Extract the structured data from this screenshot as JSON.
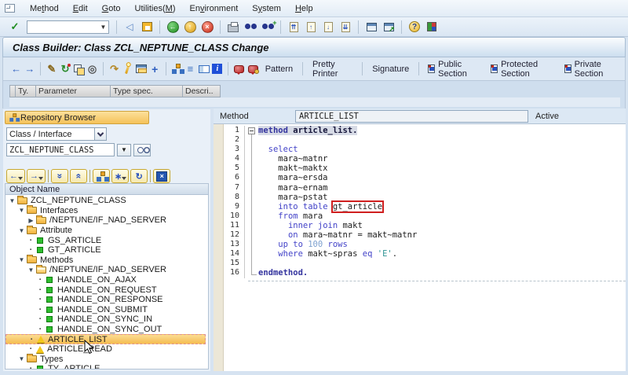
{
  "menubar": {
    "items": [
      {
        "label": "Method",
        "accel": 2
      },
      {
        "label": "Edit",
        "accel": 0
      },
      {
        "label": "Goto",
        "accel": 0
      },
      {
        "label": "Utilities(M)",
        "accel": 10
      },
      {
        "label": "Environment",
        "accel": 2
      },
      {
        "label": "System",
        "accel": 1
      },
      {
        "label": "Help",
        "accel": 0
      }
    ]
  },
  "systoolbar": {
    "command_field": {
      "value": "",
      "placeholder": ""
    },
    "icons": [
      "enter-check",
      "command-field",
      "sep",
      "enter-arrow",
      "save",
      "sep",
      "back",
      "exit",
      "cancel",
      "sep",
      "print",
      "find",
      "find-next",
      "sep",
      "first-page",
      "prev-page",
      "next-page",
      "last-page",
      "sep",
      "new-session",
      "create-shortcut",
      "sep",
      "help",
      "customize-layout"
    ]
  },
  "titlebar": {
    "title": "Class Builder: Class ZCL_NEPTUNE_CLASS Change"
  },
  "apptoolbar": {
    "icons": [
      "nav-back",
      "nav-forward",
      "sep",
      "display-change",
      "activate",
      "copy",
      "where-used",
      "sep",
      "other-object",
      "syntax-check",
      "table-view",
      "navigate",
      "sep",
      "hierarchy",
      "sort",
      "layout",
      "info",
      "sep",
      "sap-note",
      "sap-note-user"
    ],
    "text_buttons": [
      "Pattern",
      "Pretty Printer",
      "Signature"
    ],
    "section_buttons": [
      "Public Section",
      "Protected Section",
      "Private Section"
    ]
  },
  "param_table": {
    "columns": [
      "Ty.",
      "Parameter",
      "Type spec.",
      "Descri.."
    ]
  },
  "sidebar": {
    "header": "Repository Browser",
    "browser_type_value": "Class / Interface",
    "object_name_value": "ZCL_NEPTUNE_CLASS",
    "toolbar_icons": [
      "history-back",
      "history-forward",
      "sep",
      "expand-subtree",
      "collapse-subtree",
      "sep",
      "add-node",
      "display-options",
      "refresh",
      "sep",
      "close-browser"
    ],
    "tree_header": "Object Name",
    "tree": [
      {
        "label": "ZCL_NEPTUNE_CLASS",
        "level": 0,
        "icon": "folder",
        "expander": "open"
      },
      {
        "label": "Interfaces",
        "level": 1,
        "icon": "folder",
        "expander": "open"
      },
      {
        "label": "/NEPTUNE/IF_NAD_SERVER",
        "level": 2,
        "icon": "folder",
        "expander": "closed"
      },
      {
        "label": "Attribute",
        "level": 1,
        "icon": "folder",
        "expander": "open"
      },
      {
        "label": "GS_ARTICLE",
        "level": 2,
        "icon": "green-square",
        "expander": "dot"
      },
      {
        "label": "GT_ARTICLE",
        "level": 2,
        "icon": "green-square",
        "expander": "dot"
      },
      {
        "label": "Methods",
        "level": 1,
        "icon": "folder",
        "expander": "open"
      },
      {
        "label": "/NEPTUNE/IF_NAD_SERVER",
        "level": 2,
        "icon": "folder-open",
        "expander": "open"
      },
      {
        "label": "HANDLE_ON_AJAX",
        "level": 3,
        "icon": "green-square",
        "expander": "dot"
      },
      {
        "label": "HANDLE_ON_REQUEST",
        "level": 3,
        "icon": "green-square",
        "expander": "dot"
      },
      {
        "label": "HANDLE_ON_RESPONSE",
        "level": 3,
        "icon": "green-square",
        "expander": "dot"
      },
      {
        "label": "HANDLE_ON_SUBMIT",
        "level": 3,
        "icon": "green-square",
        "expander": "dot"
      },
      {
        "label": "HANDLE_ON_SYNC_IN",
        "level": 3,
        "icon": "green-square",
        "expander": "dot"
      },
      {
        "label": "HANDLE_ON_SYNC_OUT",
        "level": 3,
        "icon": "green-square",
        "expander": "dot"
      },
      {
        "label": "ARTICLE_LIST",
        "level": 2,
        "icon": "yellow-triangle",
        "expander": "dot",
        "selected": true
      },
      {
        "label": "ARTICLE_READ",
        "level": 2,
        "icon": "yellow-triangle",
        "expander": "dot"
      },
      {
        "label": "Types",
        "level": 1,
        "icon": "folder",
        "expander": "open"
      },
      {
        "label": "TY_ARTICLE",
        "level": 2,
        "icon": "green-square",
        "expander": "dot"
      }
    ]
  },
  "editor": {
    "method_label": "Method",
    "method_value": "ARTICLE_LIST",
    "status": "Active",
    "lines": [
      {
        "n": 1,
        "hl": true,
        "segs": [
          {
            "t": "method",
            "c": "kb"
          },
          {
            "t": " ",
            "c": "ib"
          },
          {
            "t": "article_list.",
            "c": "ib"
          }
        ]
      },
      {
        "n": 2,
        "segs": []
      },
      {
        "n": 3,
        "segs": [
          {
            "t": "  ",
            "c": "i"
          },
          {
            "t": "select",
            "c": "k"
          }
        ]
      },
      {
        "n": 4,
        "segs": [
          {
            "t": "    mara~matnr",
            "c": "i"
          }
        ]
      },
      {
        "n": 5,
        "segs": [
          {
            "t": "    makt~maktx",
            "c": "i"
          }
        ]
      },
      {
        "n": 6,
        "segs": [
          {
            "t": "    mara~ersda",
            "c": "i"
          }
        ]
      },
      {
        "n": 7,
        "segs": [
          {
            "t": "    mara~ernam",
            "c": "i"
          }
        ]
      },
      {
        "n": 8,
        "segs": [
          {
            "t": "    mara~pstat",
            "c": "i"
          }
        ]
      },
      {
        "n": 9,
        "segs": [
          {
            "t": "    ",
            "c": "i"
          },
          {
            "t": "into table",
            "c": "k"
          },
          {
            "t": " ",
            "c": "i"
          },
          {
            "t": "gt_article",
            "c": "i",
            "box": true
          }
        ]
      },
      {
        "n": 10,
        "segs": [
          {
            "t": "    ",
            "c": "i"
          },
          {
            "t": "from",
            "c": "k"
          },
          {
            "t": " mara",
            "c": "i"
          }
        ]
      },
      {
        "n": 11,
        "segs": [
          {
            "t": "      ",
            "c": "i"
          },
          {
            "t": "inner join",
            "c": "k"
          },
          {
            "t": " makt",
            "c": "i"
          }
        ]
      },
      {
        "n": 12,
        "segs": [
          {
            "t": "      ",
            "c": "i"
          },
          {
            "t": "on",
            "c": "k"
          },
          {
            "t": " mara~matnr = makt~matnr",
            "c": "i"
          }
        ]
      },
      {
        "n": 13,
        "segs": [
          {
            "t": "    ",
            "c": "i"
          },
          {
            "t": "up to",
            "c": "k"
          },
          {
            "t": " ",
            "c": "i"
          },
          {
            "t": "100",
            "c": "n"
          },
          {
            "t": " ",
            "c": "i"
          },
          {
            "t": "rows",
            "c": "k"
          }
        ]
      },
      {
        "n": 14,
        "segs": [
          {
            "t": "    ",
            "c": "i"
          },
          {
            "t": "where",
            "c": "k"
          },
          {
            "t": " makt~spras",
            "c": "i"
          },
          {
            "t": " ",
            "c": "i"
          },
          {
            "t": "eq",
            "c": "k"
          },
          {
            "t": " ",
            "c": "i"
          },
          {
            "t": "'E'",
            "c": "s"
          },
          {
            "t": ".",
            "c": "i"
          }
        ]
      },
      {
        "n": 15,
        "segs": []
      },
      {
        "n": 16,
        "segs": [
          {
            "t": "endmethod.",
            "c": "kb"
          }
        ]
      }
    ]
  },
  "colors": {
    "chrome": "#dce8f4",
    "selection": "#f5bc50",
    "keyword": "#4343c8",
    "string": "#2e9494",
    "number": "#7da0cf",
    "error_box": "#cf1f1f",
    "repo_header": "#f5c25a"
  }
}
